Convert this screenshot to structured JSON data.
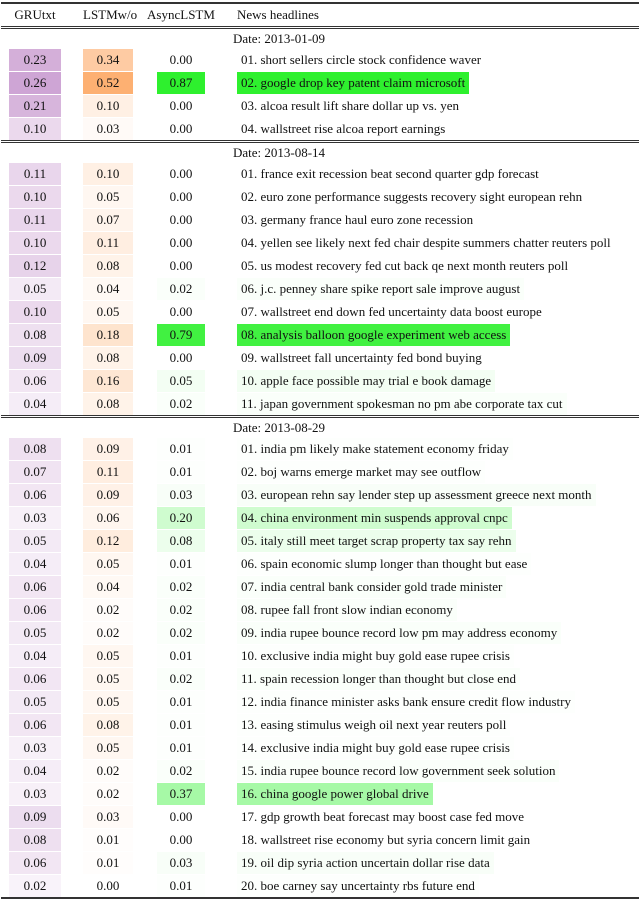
{
  "header": {
    "col1": "GRUtxt",
    "col2": "LSTMw/o",
    "col3": "AsyncLSTM",
    "col4": "News headlines"
  },
  "colors": {
    "gru_max": "#c99bd0",
    "lstm_max": "#fdb072",
    "async_max": "#2ef02e"
  },
  "sections": [
    {
      "date": "Date: 2013-01-09",
      "rows": [
        {
          "gru": "0.23",
          "lstm": "0.34",
          "async": "0.00",
          "headline": "01. short sellers circle stock confidence waver"
        },
        {
          "gru": "0.26",
          "lstm": "0.52",
          "async": "0.87",
          "headline": "02. google drop key patent claim microsoft"
        },
        {
          "gru": "0.21",
          "lstm": "0.10",
          "async": "0.00",
          "headline": "03. alcoa result lift share dollar up vs. yen"
        },
        {
          "gru": "0.10",
          "lstm": "0.03",
          "async": "0.00",
          "headline": "04. wallstreet rise alcoa report earnings"
        }
      ]
    },
    {
      "date": "Date: 2013-08-14",
      "rows": [
        {
          "gru": "0.11",
          "lstm": "0.10",
          "async": "0.00",
          "headline": "01. france exit recession beat second quarter gdp forecast"
        },
        {
          "gru": "0.10",
          "lstm": "0.05",
          "async": "0.00",
          "headline": "02. euro zone performance suggests recovery sight european rehn"
        },
        {
          "gru": "0.11",
          "lstm": "0.07",
          "async": "0.00",
          "headline": "03. germany france haul euro zone recession"
        },
        {
          "gru": "0.10",
          "lstm": "0.11",
          "async": "0.00",
          "headline": "04. yellen see likely next fed chair despite summers chatter reuters poll"
        },
        {
          "gru": "0.12",
          "lstm": "0.08",
          "async": "0.00",
          "headline": "05. us modest recovery fed cut back qe next month reuters poll"
        },
        {
          "gru": "0.05",
          "lstm": "0.04",
          "async": "0.02",
          "headline": "06. j.c. penney share spike report sale improve august"
        },
        {
          "gru": "0.10",
          "lstm": "0.05",
          "async": "0.00",
          "headline": "07. wallstreet end down fed uncertainty data boost europe"
        },
        {
          "gru": "0.08",
          "lstm": "0.18",
          "async": "0.79",
          "headline": "08. analysis balloon google experiment web access"
        },
        {
          "gru": "0.09",
          "lstm": "0.08",
          "async": "0.00",
          "headline": "09. wallstreet fall uncertainty fed bond buying"
        },
        {
          "gru": "0.06",
          "lstm": "0.16",
          "async": "0.05",
          "headline": "10. apple face possible may trial e book damage"
        },
        {
          "gru": "0.04",
          "lstm": "0.08",
          "async": "0.02",
          "headline": "11. japan government spokesman no pm abe corporate tax cut"
        }
      ]
    },
    {
      "date": "Date: 2013-08-29",
      "rows": [
        {
          "gru": "0.08",
          "lstm": "0.09",
          "async": "0.01",
          "headline": "01. india pm likely make statement economy friday"
        },
        {
          "gru": "0.07",
          "lstm": "0.11",
          "async": "0.01",
          "headline": "02. boj warns emerge market may see outflow"
        },
        {
          "gru": "0.06",
          "lstm": "0.09",
          "async": "0.03",
          "headline": "03. european rehn say lender step up assessment greece next month"
        },
        {
          "gru": "0.03",
          "lstm": "0.06",
          "async": "0.20",
          "headline": "04. china environment min suspends approval cnpc"
        },
        {
          "gru": "0.05",
          "lstm": "0.12",
          "async": "0.08",
          "headline": "05. italy still meet target scrap property tax say rehn"
        },
        {
          "gru": "0.04",
          "lstm": "0.05",
          "async": "0.01",
          "headline": "06. spain economic slump longer than thought but ease"
        },
        {
          "gru": "0.06",
          "lstm": "0.04",
          "async": "0.02",
          "headline": "07. india central bank consider gold trade minister"
        },
        {
          "gru": "0.06",
          "lstm": "0.02",
          "async": "0.02",
          "headline": "08. rupee fall front slow indian economy"
        },
        {
          "gru": "0.05",
          "lstm": "0.02",
          "async": "0.02",
          "headline": "09. india rupee bounce record low pm may address economy"
        },
        {
          "gru": "0.04",
          "lstm": "0.05",
          "async": "0.01",
          "headline": "10. exclusive india might buy gold ease rupee crisis"
        },
        {
          "gru": "0.06",
          "lstm": "0.05",
          "async": "0.02",
          "headline": "11. spain recession longer than thought but close end"
        },
        {
          "gru": "0.05",
          "lstm": "0.05",
          "async": "0.01",
          "headline": "12. india finance minister asks bank ensure credit flow industry"
        },
        {
          "gru": "0.06",
          "lstm": "0.08",
          "async": "0.01",
          "headline": "13. easing stimulus weigh oil next year reuters poll"
        },
        {
          "gru": "0.03",
          "lstm": "0.05",
          "async": "0.01",
          "headline": "14. exclusive india might buy gold ease rupee crisis"
        },
        {
          "gru": "0.04",
          "lstm": "0.02",
          "async": "0.02",
          "headline": "15. india rupee bounce record low government seek solution"
        },
        {
          "gru": "0.03",
          "lstm": "0.02",
          "async": "0.37",
          "headline": "16. china google power global drive"
        },
        {
          "gru": "0.09",
          "lstm": "0.03",
          "async": "0.00",
          "headline": "17. gdp growth beat forecast may boost case fed move"
        },
        {
          "gru": "0.08",
          "lstm": "0.01",
          "async": "0.00",
          "headline": "18. wallstreet rise economy but syria concern limit gain"
        },
        {
          "gru": "0.06",
          "lstm": "0.01",
          "async": "0.03",
          "headline": "19. oil dip syria action uncertain dollar rise data"
        },
        {
          "gru": "0.02",
          "lstm": "0.00",
          "async": "0.01",
          "headline": "20. boe carney say uncertainty rbs future end"
        }
      ]
    }
  ]
}
